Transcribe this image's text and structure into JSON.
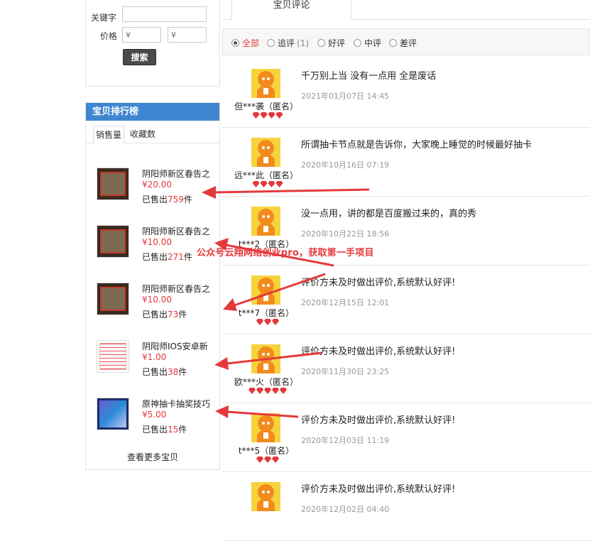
{
  "search": {
    "keyword_label": "关键字",
    "price_label": "价格",
    "price_min_placeholder": "¥",
    "price_max_placeholder": "¥",
    "button_label": "搜索"
  },
  "ranking": {
    "title": "宝贝排行榜",
    "tabs": [
      "销售量",
      "收藏数"
    ],
    "sold_prefix": "已售出",
    "sold_suffix": "件",
    "items": [
      {
        "name": "阴阳师新区春告之",
        "price": "¥20.00",
        "sold": "759"
      },
      {
        "name": "阴阳师新区春告之",
        "price": "¥10.00",
        "sold": "271"
      },
      {
        "name": "阴阳师新区春告之",
        "price": "¥10.00",
        "sold": "73"
      },
      {
        "name": "阴阳师IOS安卓新",
        "price": "¥1.00",
        "sold": "38"
      },
      {
        "name": "原神抽卡抽奖技巧",
        "price": "¥5.00",
        "sold": "15"
      }
    ],
    "more_link": "查看更多宝贝"
  },
  "reviews_tab": {
    "label": "宝贝评论"
  },
  "filters": [
    {
      "label": "全部",
      "count": "",
      "checked": true
    },
    {
      "label": "追评",
      "count": "(1)",
      "checked": false
    },
    {
      "label": "好评",
      "count": "",
      "checked": false
    },
    {
      "label": "中评",
      "count": "",
      "checked": false
    },
    {
      "label": "差评",
      "count": "",
      "checked": false
    }
  ],
  "reviews": [
    {
      "user": "但***袭（匿名）",
      "stars": 4,
      "content": "千万别上当 没有一点用 全是废话",
      "time": "2021年01月07日 14:45"
    },
    {
      "user": "远***此（匿名）",
      "stars": 4,
      "content": "所谓抽卡节点就是告诉你，大家晚上睡觉的时候最好抽卡",
      "time": "2020年10月16日 07:19"
    },
    {
      "user": "t***2（匿名）",
      "stars": 0,
      "content": "没一点用，讲的都是百度搬过来的，真的秀",
      "time": "2020年10月22日 18:56"
    },
    {
      "user": "t***7（匿名）",
      "stars": 3,
      "content": "评价方未及时做出评价,系统默认好评!",
      "time": "2020年12月15日 12:01"
    },
    {
      "user": "欧***火（匿名）",
      "stars": 5,
      "content": "评价方未及时做出评价,系统默认好评!",
      "time": "2020年11月30日 23:25"
    },
    {
      "user": "t***5（匿名）",
      "stars": 3,
      "content": "评价方未及时做出评价,系统默认好评!",
      "time": "2020年12月03日 11:19"
    },
    {
      "user": "",
      "stars": 0,
      "content": "评价方未及时做出评价,系统默认好评!",
      "time": "2020年12月02日 04:40"
    }
  ],
  "overlay": {
    "watermark": "公众号云翔网络创业pro，获取第一手项目",
    "arrow_color": "#e4393c"
  }
}
